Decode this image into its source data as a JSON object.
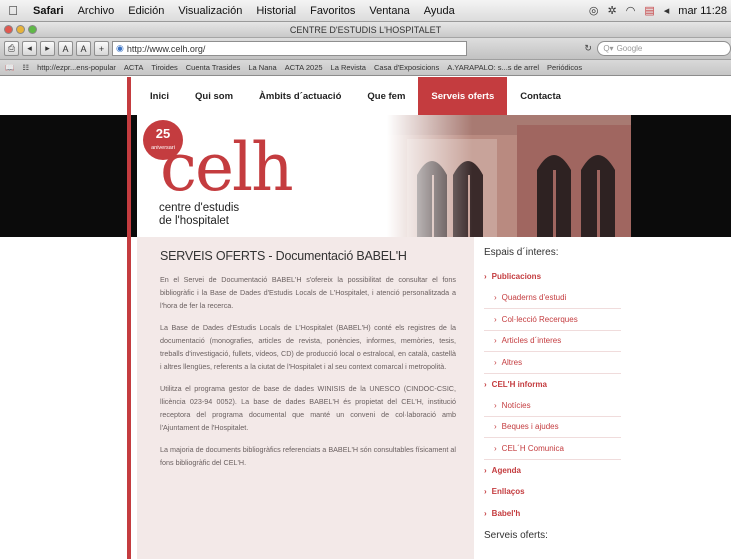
{
  "menubar": {
    "app": "Safari",
    "items": [
      "Archivo",
      "Edición",
      "Visualización",
      "Historial",
      "Favoritos",
      "Ventana",
      "Ayuda"
    ],
    "clock": "mar 11:28"
  },
  "window": {
    "title": "CENTRE D'ESTUDIS L'HOSPITALET"
  },
  "toolbar": {
    "url": "http://www.celh.org/",
    "search_placeholder": "Google",
    "font_small": "A",
    "font_large": "A",
    "add": "+"
  },
  "bookmarks": [
    "http://ezpr...ens-popular",
    "ACTA",
    "Tiroides",
    "Cuenta Trasides",
    "La Nana",
    "ACTA 2025",
    "La Revista",
    "Casa d'Exposicions",
    "A.YARAPALO: s...s de arrel",
    "Periódicos"
  ],
  "site": {
    "nav": [
      {
        "label": "Inici"
      },
      {
        "label": "Qui som"
      },
      {
        "label": "Àmbits d´actuació"
      },
      {
        "label": "Que fem"
      },
      {
        "label": "Serveis oferts"
      },
      {
        "label": "Contacta"
      }
    ],
    "badge_number": "25",
    "badge_sub": "aniversari",
    "logo_word": "celh",
    "logo_line1": "centre d'estudis",
    "logo_line2": "de l'hospitalet",
    "page_title": "SERVEIS OFERTS - Documentació BABEL'H",
    "paragraphs": [
      "En el Servei de Documentació BABEL'H s'ofereix la possibilitat de consultar el fons bibliogràfic i la Base de Dades d'Estudis Locals de L'Hospitalet, i atenció personalitzada a l'hora de fer la recerca.",
      "La Base de Dades d'Estudis Locals de L'Hospitalet (BABEL'H) conté els registres de la documentació (monografies, articles de revista, ponències, informes, memòries, tesis, treballs d'investigació, fullets, vídeos, CD) de producció local o estralocal, en català, castellà i altres llengües, referents a la ciutat de l'Hospitalet i al seu context comarcal i metropolità.",
      "Utilitza el programa gestor de base de dades WINISIS de la UNESCO (CINDOC-CSIC, llicència 023-94 0052). La base de dades BABEL'H és propietat del CEL'H, institució receptora del programa documental que manté un conveni de col·laboració amb l'Ajuntament de l'Hospitalet.",
      "La majoria de documents bibliogràfics referenciats a BABEL'H són consultables físicament al fons bibliogràfic del CEL'H."
    ],
    "sidebar": {
      "heading": "Espais d´interes:",
      "items": [
        {
          "label": "Publicacions",
          "level": "top"
        },
        {
          "label": "Quaderns d'estudi",
          "level": "sub"
        },
        {
          "label": "Col·lecció Recerques",
          "level": "sub"
        },
        {
          "label": "Articles d´interes",
          "level": "sub"
        },
        {
          "label": "Altres",
          "level": "sub"
        },
        {
          "label": "CEL'H informa",
          "level": "top"
        },
        {
          "label": "Notícies",
          "level": "sub"
        },
        {
          "label": "Beques i ajudes",
          "level": "sub"
        },
        {
          "label": "CEL´H Comunica",
          "level": "sub"
        },
        {
          "label": "Agenda",
          "level": "top"
        },
        {
          "label": "Enllaços",
          "level": "top"
        },
        {
          "label": "Babel'h",
          "level": "top"
        }
      ],
      "heading2": "Serveis oferts:"
    }
  },
  "colors": {
    "accent": "#c43c3f",
    "content_bg": "#f3e9e8",
    "banner_bg": "#0b0b0b"
  }
}
